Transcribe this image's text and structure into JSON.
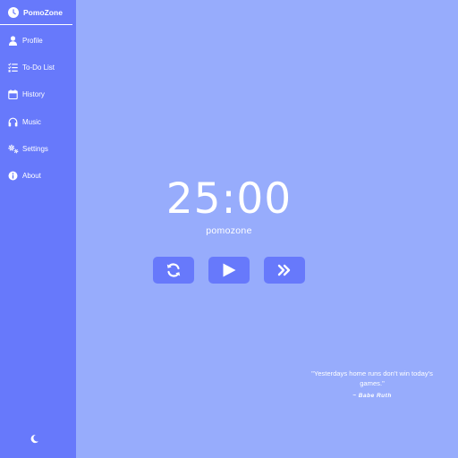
{
  "app": {
    "title": "PomoZone"
  },
  "sidebar": {
    "items": [
      {
        "label": "Profile",
        "icon": "user-icon"
      },
      {
        "label": "To-Do List",
        "icon": "checklist-icon"
      },
      {
        "label": "History",
        "icon": "calendar-icon"
      },
      {
        "label": "Music",
        "icon": "headphones-icon"
      },
      {
        "label": "Settings",
        "icon": "gear-icon"
      },
      {
        "label": "About",
        "icon": "info-icon"
      }
    ],
    "theme_toggle_icon": "moon-icon"
  },
  "timer": {
    "time": "25:00",
    "label": "pomozone"
  },
  "controls": [
    {
      "action": "reset",
      "icon": "refresh-icon"
    },
    {
      "action": "start",
      "icon": "play-icon"
    },
    {
      "action": "skip",
      "icon": "fast-forward-icon"
    }
  ],
  "quote": {
    "text": "\"Yesterdays home runs don't win today's games.\"",
    "author": "~ Babe Ruth"
  },
  "colors": {
    "background": "#97acfc",
    "sidebar": "#6779fb",
    "button": "#6779fb",
    "text": "#ffffff"
  }
}
